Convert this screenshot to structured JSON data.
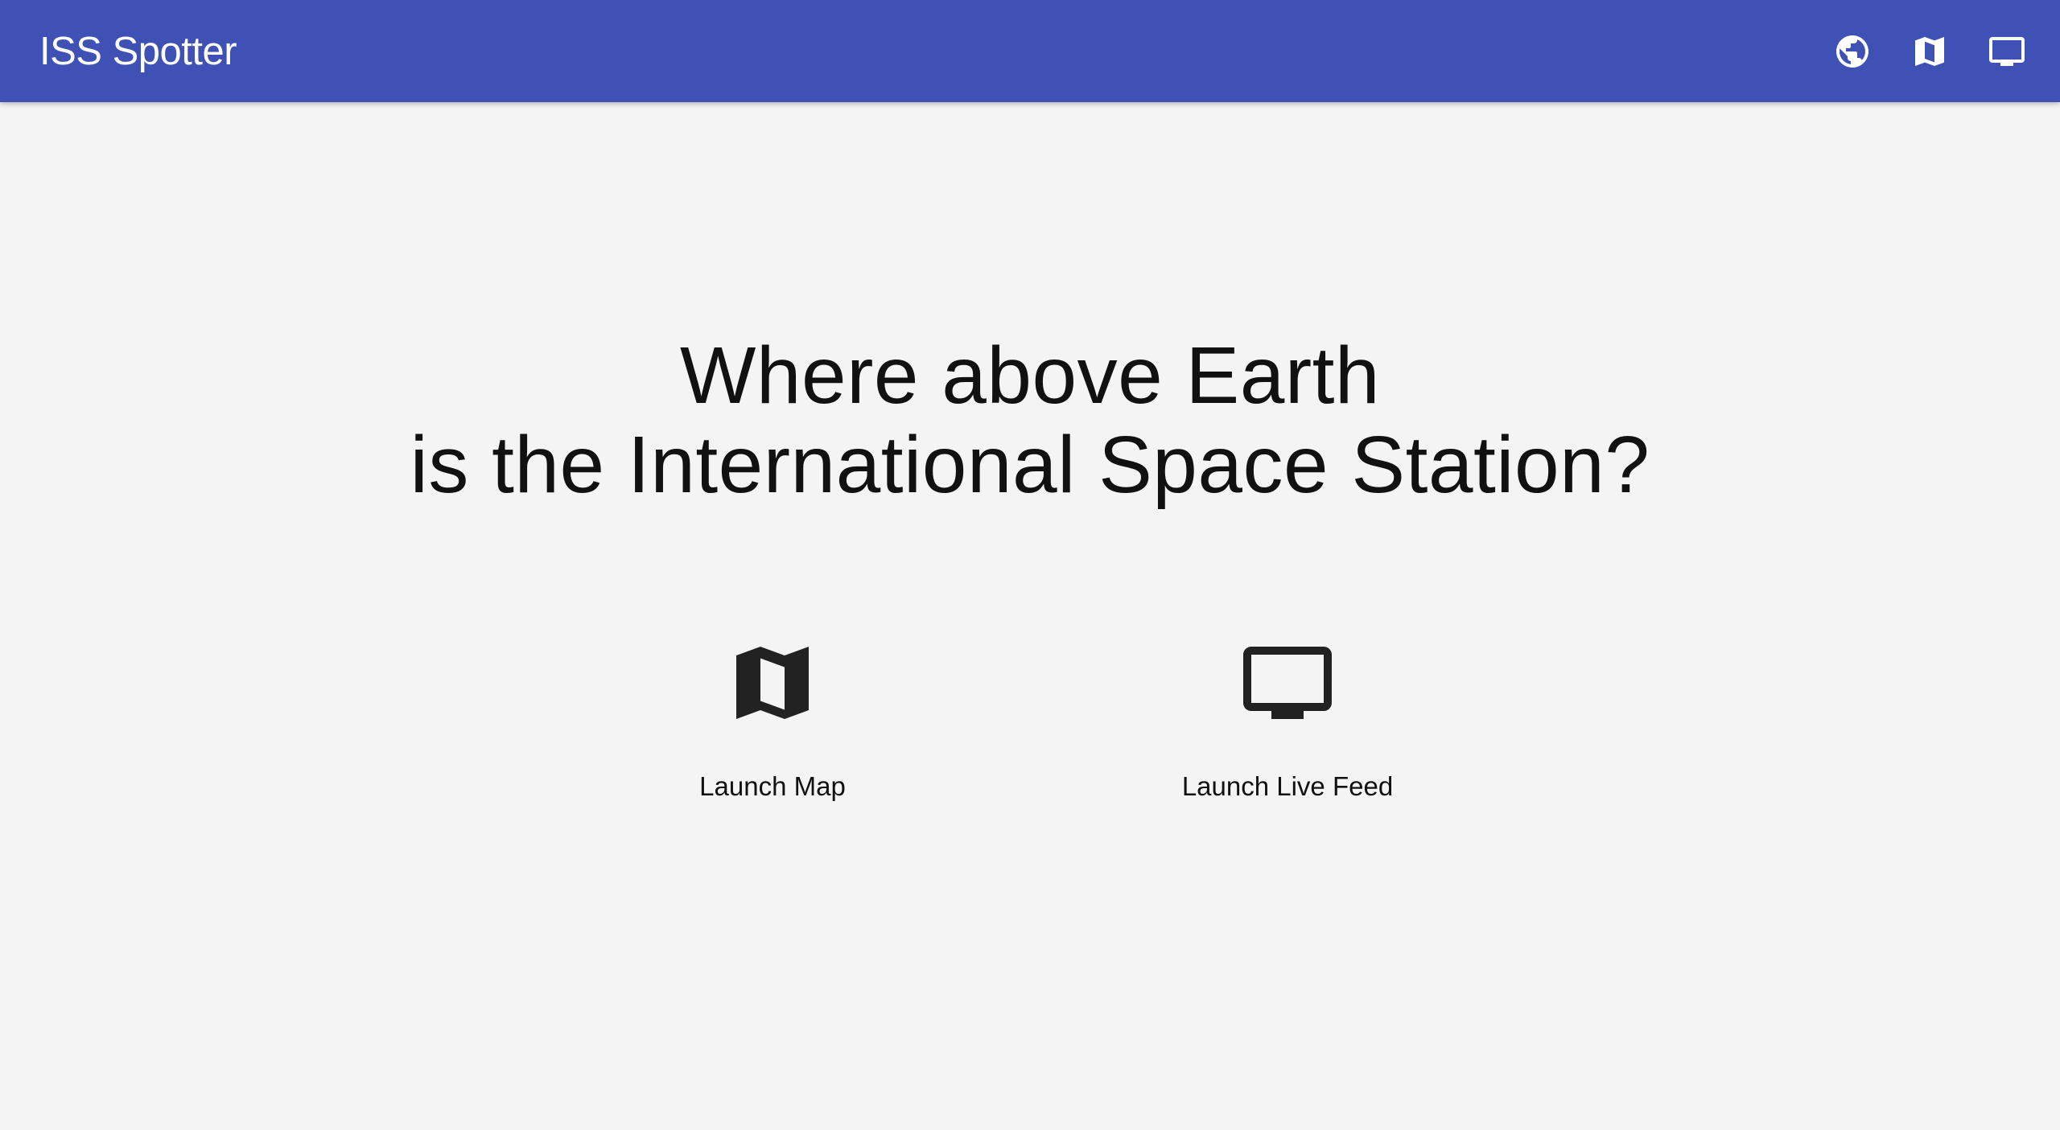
{
  "appbar": {
    "title": "ISS Spotter",
    "background": "#3f51b5",
    "actions": [
      {
        "icon": "globe-icon"
      },
      {
        "icon": "map-icon"
      },
      {
        "icon": "tv-icon"
      }
    ]
  },
  "main": {
    "headline_line1": "Where above Earth",
    "headline_line2": "is the International Space Station?",
    "launchers": [
      {
        "icon": "map-icon",
        "label": "Launch Map"
      },
      {
        "icon": "tv-icon",
        "label": "Launch Live Feed"
      }
    ]
  }
}
